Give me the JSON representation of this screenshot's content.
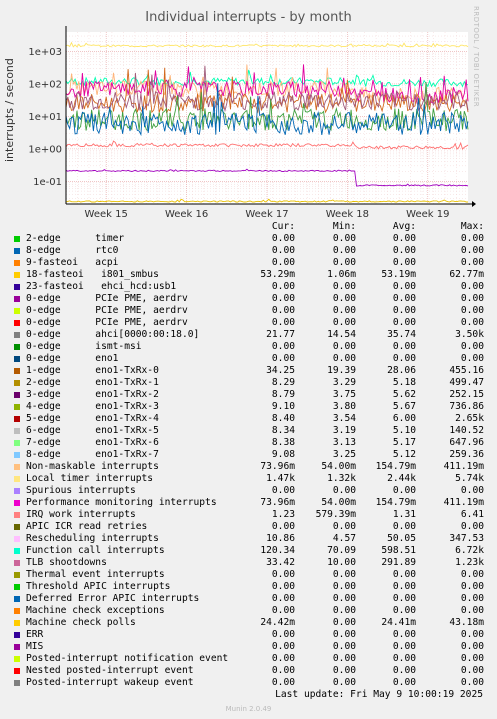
{
  "chart_data": {
    "type": "line",
    "title": "Individual interrupts - by month",
    "ylabel": "interrupts / second",
    "yscale": "log",
    "ylim": [
      0.02,
      4000
    ],
    "y_ticks": [
      "1e-01",
      "1e+00",
      "1e+01",
      "1e+02",
      "1e+03"
    ],
    "y_tick_values": [
      0.1,
      1,
      10,
      100,
      1000
    ],
    "x_ticks": [
      "Week 15",
      "Week 16",
      "Week 17",
      "Week 18",
      "Week 19"
    ],
    "x_tick_positions": [
      0.5,
      1.5,
      2.5,
      3.5,
      4.5
    ],
    "xlim": [
      0,
      5
    ],
    "grid": true,
    "series": [
      {
        "name": "Function call interrupts",
        "color": "#00ffb0",
        "level": 120,
        "jitter": 0.12,
        "after": 110,
        "shift": 3.6
      },
      {
        "name": "Local timer interrupts",
        "color": "#ffe566",
        "level": 1500,
        "jitter": 0.03,
        "after": 1500,
        "shift": 3.6
      },
      {
        "name": "Non-maskable interrupts",
        "color": "#ffb57a",
        "level": 70,
        "jitter": 0.25,
        "after": 45,
        "shift": 3.6
      },
      {
        "name": "Performance monitoring interrupts",
        "color": "#e000a0",
        "level": 70,
        "jitter": 0.25,
        "after": 45,
        "shift": 3.6
      },
      {
        "name": "Rescheduling interrupts",
        "color": "#d2691e",
        "level": 25,
        "jitter": 0.3,
        "after": 25,
        "shift": 3.6
      },
      {
        "name": "TLB shootdowns",
        "color": "#a05a7a",
        "level": 30,
        "jitter": 0.3,
        "after": 30,
        "shift": 3.6
      },
      {
        "name": "ahci[0000:00:18.0]",
        "color": "#40a040",
        "level": 8,
        "jitter": 0.35,
        "after": 8,
        "shift": 3.6
      },
      {
        "name": "eno1-TxRx-0",
        "color": "#0066b3",
        "level": 6,
        "jitter": 0.35,
        "after": 6,
        "shift": 3.6
      },
      {
        "name": "IRQ work interrupts",
        "color": "#ff7070",
        "level": 1.3,
        "jitter": 0.05,
        "after": 1.1,
        "shift": 3.6
      },
      {
        "name": "i801_smbus",
        "color": "#a000c0",
        "level": 0.21,
        "jitter": 0.02,
        "after": 0.075,
        "shift": 3.6
      },
      {
        "name": "Machine check polls",
        "color": "#e8c000",
        "level": 0.024,
        "jitter": 0.02,
        "after": 0.024,
        "shift": 3.6
      }
    ]
  },
  "legend": {
    "headers": {
      "cur": "Cur:",
      "min": "Min:",
      "avg": "Avg:",
      "max": "Max:"
    },
    "rows": [
      {
        "color": "#00cc00",
        "label": "2-edge      timer",
        "cur": "0.00",
        "min": "0.00",
        "avg": "0.00",
        "max": "0.00"
      },
      {
        "color": "#0066b3",
        "label": "8-edge      rtc0",
        "cur": "0.00",
        "min": "0.00",
        "avg": "0.00",
        "max": "0.00"
      },
      {
        "color": "#ff8000",
        "label": "9-fasteoi   acpi",
        "cur": "0.00",
        "min": "0.00",
        "avg": "0.00",
        "max": "0.00"
      },
      {
        "color": "#ffcc00",
        "label": "18-fasteoi   i801_smbus",
        "cur": "53.29m",
        "min": "1.06m",
        "avg": "53.19m",
        "max": "62.77m"
      },
      {
        "color": "#330099",
        "label": "23-fasteoi   ehci_hcd:usb1",
        "cur": "0.00",
        "min": "0.00",
        "avg": "0.00",
        "max": "0.00"
      },
      {
        "color": "#990099",
        "label": "0-edge      PCIe PME, aerdrv",
        "cur": "0.00",
        "min": "0.00",
        "avg": "0.00",
        "max": "0.00"
      },
      {
        "color": "#ccff00",
        "label": "0-edge      PCIe PME, aerdrv",
        "cur": "0.00",
        "min": "0.00",
        "avg": "0.00",
        "max": "0.00"
      },
      {
        "color": "#ff0000",
        "label": "0-edge      PCIe PME, aerdrv",
        "cur": "0.00",
        "min": "0.00",
        "avg": "0.00",
        "max": "0.00"
      },
      {
        "color": "#808080",
        "label": "0-edge      ahci[0000:00:18.0]",
        "cur": "21.77",
        "min": "14.54",
        "avg": "35.74",
        "max": "3.50k"
      },
      {
        "color": "#008f00",
        "label": "0-edge      ismt-msi",
        "cur": "0.00",
        "min": "0.00",
        "avg": "0.00",
        "max": "0.00"
      },
      {
        "color": "#00487d",
        "label": "0-edge      eno1",
        "cur": "0.00",
        "min": "0.00",
        "avg": "0.00",
        "max": "0.00"
      },
      {
        "color": "#b35a00",
        "label": "1-edge      eno1-TxRx-0",
        "cur": "34.25",
        "min": "19.39",
        "avg": "28.06",
        "max": "455.16"
      },
      {
        "color": "#b38f00",
        "label": "2-edge      eno1-TxRx-1",
        "cur": "8.29",
        "min": "3.29",
        "avg": "5.18",
        "max": "499.47"
      },
      {
        "color": "#6b006b",
        "label": "3-edge      eno1-TxRx-2",
        "cur": "8.79",
        "min": "3.75",
        "avg": "5.62",
        "max": "252.15"
      },
      {
        "color": "#8fb300",
        "label": "4-edge      eno1-TxRx-3",
        "cur": "9.10",
        "min": "3.80",
        "avg": "5.67",
        "max": "736.86"
      },
      {
        "color": "#b30000",
        "label": "5-edge      eno1-TxRx-4",
        "cur": "8.40",
        "min": "3.54",
        "avg": "6.00",
        "max": "2.65k"
      },
      {
        "color": "#bebebe",
        "label": "6-edge      eno1-TxRx-5",
        "cur": "8.34",
        "min": "3.19",
        "avg": "5.10",
        "max": "140.52"
      },
      {
        "color": "#80ff80",
        "label": "7-edge      eno1-TxRx-6",
        "cur": "8.38",
        "min": "3.13",
        "avg": "5.17",
        "max": "647.96"
      },
      {
        "color": "#80c9ff",
        "label": "8-edge      eno1-TxRx-7",
        "cur": "9.08",
        "min": "3.25",
        "avg": "5.12",
        "max": "259.36"
      },
      {
        "color": "#ffc080",
        "label": "Non-maskable interrupts",
        "cur": "73.96m",
        "min": "54.00m",
        "avg": "154.79m",
        "max": "411.19m"
      },
      {
        "color": "#ffe680",
        "label": "Local timer interrupts",
        "cur": "1.47k",
        "min": "1.32k",
        "avg": "2.44k",
        "max": "5.74k"
      },
      {
        "color": "#aa80ff",
        "label": "Spurious interrupts",
        "cur": "0.00",
        "min": "0.00",
        "avg": "0.00",
        "max": "0.00"
      },
      {
        "color": "#ee00cc",
        "label": "Performance monitoring interrupts",
        "cur": "73.96m",
        "min": "54.00m",
        "avg": "154.79m",
        "max": "411.19m"
      },
      {
        "color": "#ff8080",
        "label": "IRQ work interrupts",
        "cur": "1.23",
        "min": "579.39m",
        "avg": "1.31",
        "max": "6.41"
      },
      {
        "color": "#666600",
        "label": "APIC ICR read retries",
        "cur": "0.00",
        "min": "0.00",
        "avg": "0.00",
        "max": "0.00"
      },
      {
        "color": "#ffbfff",
        "label": "Rescheduling interrupts",
        "cur": "10.86",
        "min": "4.57",
        "avg": "50.05",
        "max": "347.53"
      },
      {
        "color": "#00ffcc",
        "label": "Function call interrupts",
        "cur": "120.34",
        "min": "70.09",
        "avg": "598.51",
        "max": "6.72k"
      },
      {
        "color": "#cc6699",
        "label": "TLB shootdowns",
        "cur": "33.42",
        "min": "10.00",
        "avg": "291.89",
        "max": "1.23k"
      },
      {
        "color": "#999900",
        "label": "Thermal event interrupts",
        "cur": "0.00",
        "min": "0.00",
        "avg": "0.00",
        "max": "0.00"
      },
      {
        "color": "#00cc00",
        "label": "Threshold APIC interrupts",
        "cur": "0.00",
        "min": "0.00",
        "avg": "0.00",
        "max": "0.00"
      },
      {
        "color": "#0066b3",
        "label": "Deferred Error APIC interrupts",
        "cur": "0.00",
        "min": "0.00",
        "avg": "0.00",
        "max": "0.00"
      },
      {
        "color": "#ff8000",
        "label": "Machine check exceptions",
        "cur": "0.00",
        "min": "0.00",
        "avg": "0.00",
        "max": "0.00"
      },
      {
        "color": "#ffcc00",
        "label": "Machine check polls",
        "cur": "24.42m",
        "min": "0.00",
        "avg": "24.41m",
        "max": "43.18m"
      },
      {
        "color": "#330099",
        "label": "ERR",
        "cur": "0.00",
        "min": "0.00",
        "avg": "0.00",
        "max": "0.00"
      },
      {
        "color": "#990099",
        "label": "MIS",
        "cur": "0.00",
        "min": "0.00",
        "avg": "0.00",
        "max": "0.00"
      },
      {
        "color": "#ccff00",
        "label": "Posted-interrupt notification event",
        "cur": "0.00",
        "min": "0.00",
        "avg": "0.00",
        "max": "0.00"
      },
      {
        "color": "#ff0000",
        "label": "Nested posted-interrupt event",
        "cur": "0.00",
        "min": "0.00",
        "avg": "0.00",
        "max": "0.00"
      },
      {
        "color": "#808080",
        "label": "Posted-interrupt wakeup event",
        "cur": "0.00",
        "min": "0.00",
        "avg": "0.00",
        "max": "0.00"
      }
    ]
  },
  "last_update": "Last update: Fri May  9 10:00:19 2025",
  "watermark": "RRDTOOL / TOBI OETIKER",
  "footer": "Munin 2.0.49"
}
